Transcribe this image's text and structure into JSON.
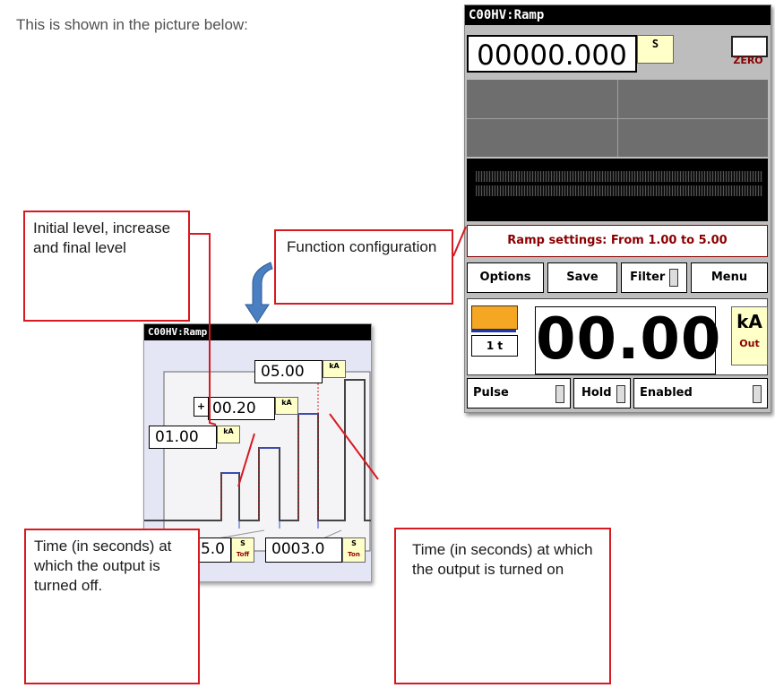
{
  "intro_text": "This is shown in the picture below:",
  "device": {
    "title": "C00HV:Ramp",
    "time_value": "00000.000",
    "time_unit": "S",
    "zero_label": "ZERO",
    "ramp_settings": "Ramp settings: From 1.00 to 5.00",
    "buttons": {
      "options": "Options",
      "save": "Save",
      "filter": "Filter",
      "menu": "Menu"
    },
    "range_label": "1 t",
    "output_value": "00.00",
    "output_unit": "kA",
    "output_sub": "Out",
    "bottom": {
      "pulse": "Pulse",
      "hold": "Hold",
      "enabled": "Enabled"
    }
  },
  "ramp_window": {
    "title": "C00HV:Ramp",
    "final_level": "05.00",
    "increment_sign": "+",
    "increment": "00.20",
    "initial_level": "01.00",
    "level_unit": "kA",
    "toff_value": "5.0",
    "ton_value": "0003.0",
    "time_unit": "S",
    "toff_label": "Toff",
    "ton_label": "Ton"
  },
  "callouts": {
    "levels": "Initial level, increase and final level",
    "function": "Function configuration",
    "toff": "Time (in seconds) at which the output is turned off.",
    "ton": "Time (in seconds) at which the output is turned on"
  },
  "colors": {
    "callout_border": "#d71920",
    "accent_orange": "#f5a623",
    "dark_red": "#8b0000",
    "arrow_blue": "#4a7fc1"
  }
}
